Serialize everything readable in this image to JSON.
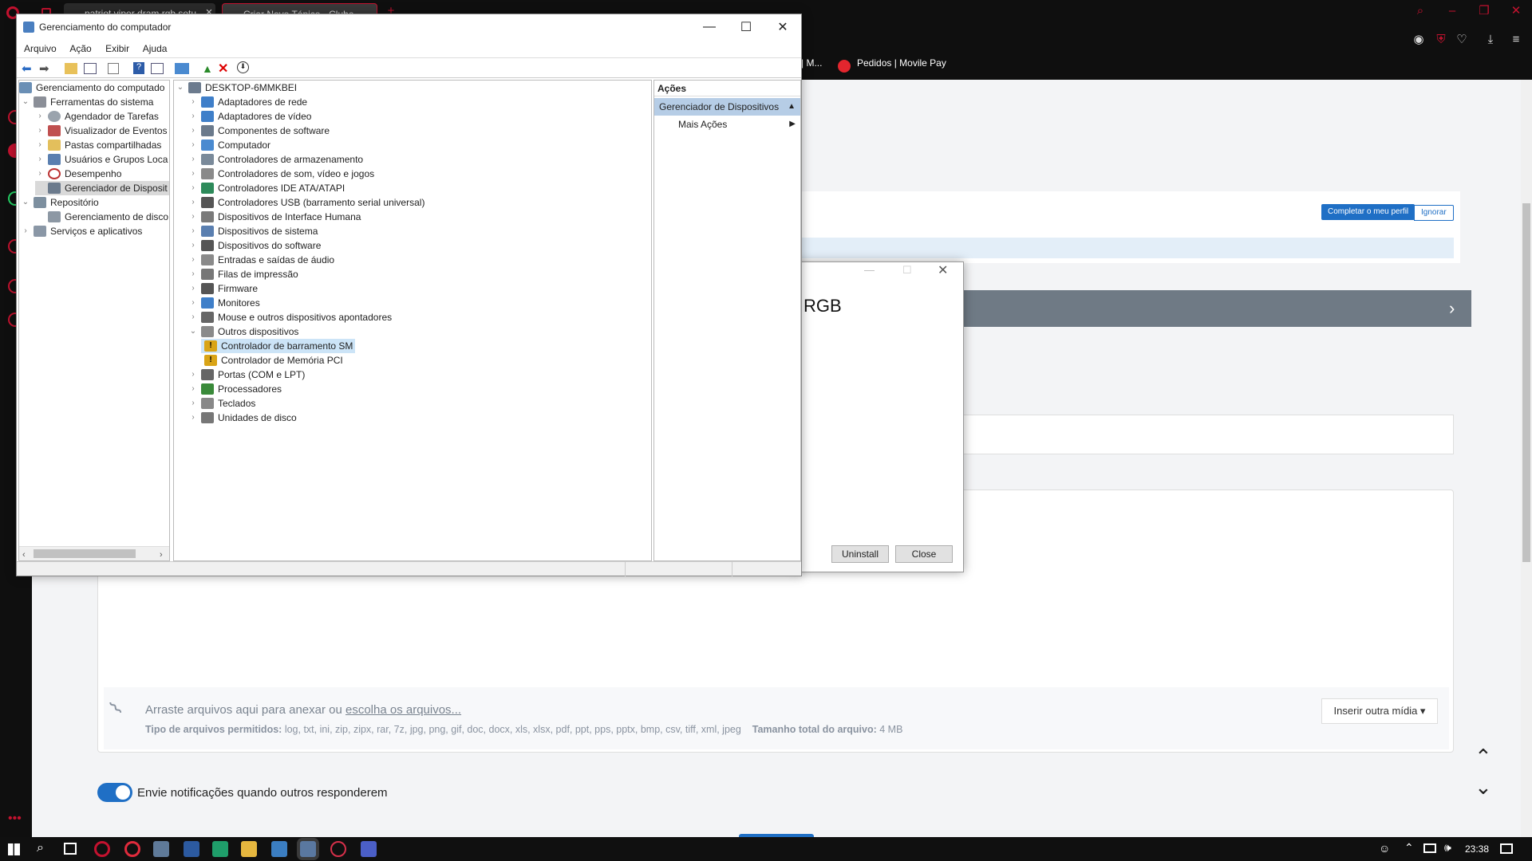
{
  "browser": {
    "tabs": [
      {
        "title": "patriot viper dram rgb setu"
      },
      {
        "title": "Criar Novo Tópico - Clube"
      }
    ],
    "bookmarks": [
      {
        "label": "| M..."
      },
      {
        "label": "Pedidos | Movile Pay"
      }
    ]
  },
  "forum": {
    "profile_complete_label": "Completar o meu perfil",
    "profile_ignore_label": "Ignorar",
    "attach_text": "Arraste arquivos aqui para anexar ou",
    "attach_link": "escolha os arquivos...",
    "allowed_types_label": "Tipo de arquivos permitidos:",
    "allowed_types": "log, txt, ini, zip, zipx, rar, 7z, jpg, png, gif, doc, docx, xls, xlsx, pdf, ppt, pps, pptx, bmp, csv, tiff, xml, jpeg",
    "total_size_label": "Tamanho total do arquivo:",
    "total_size": "4 MB",
    "insert_media_label": "Inserir outra mídia ▾",
    "notify_label": "Envie notificações quando outros responderem",
    "notify_on": true
  },
  "dialog": {
    "title_fragment": "RGB",
    "uninstall_label": "Uninstall",
    "close_label": "Close"
  },
  "mmc": {
    "title": "Gerenciamento do computador",
    "menu": [
      "Arquivo",
      "Ação",
      "Exibir",
      "Ajuda"
    ],
    "left_tree": [
      {
        "label": "Gerenciamento do computado"
      },
      {
        "label": "Ferramentas do sistema"
      },
      {
        "label": "Agendador de Tarefas"
      },
      {
        "label": "Visualizador de Eventos"
      },
      {
        "label": "Pastas compartilhadas"
      },
      {
        "label": "Usuários e Grupos Loca"
      },
      {
        "label": "Desempenho"
      },
      {
        "label": "Gerenciador de Disposit"
      },
      {
        "label": "Repositório"
      },
      {
        "label": "Gerenciamento de disco"
      },
      {
        "label": "Serviços e aplicativos"
      }
    ],
    "device_root": "DESKTOP-6MMKBEI",
    "devices": [
      {
        "label": "Adaptadores de rede"
      },
      {
        "label": "Adaptadores de vídeo"
      },
      {
        "label": "Componentes de software"
      },
      {
        "label": "Computador"
      },
      {
        "label": "Controladores de armazenamento"
      },
      {
        "label": "Controladores de som, vídeo e jogos"
      },
      {
        "label": "Controladores IDE ATA/ATAPI"
      },
      {
        "label": "Controladores USB (barramento serial universal)"
      },
      {
        "label": "Dispositivos de Interface Humana"
      },
      {
        "label": "Dispositivos de sistema"
      },
      {
        "label": "Dispositivos do software"
      },
      {
        "label": "Entradas e saídas de áudio"
      },
      {
        "label": "Filas de impressão"
      },
      {
        "label": "Firmware"
      },
      {
        "label": "Monitores"
      },
      {
        "label": "Mouse e outros dispositivos apontadores"
      },
      {
        "label": "Outros dispositivos"
      },
      {
        "label": "Controlador de barramento SM"
      },
      {
        "label": "Controlador de Memória PCI"
      },
      {
        "label": "Portas (COM e LPT)"
      },
      {
        "label": "Processadores"
      },
      {
        "label": "Teclados"
      },
      {
        "label": "Unidades de disco"
      }
    ],
    "actions_header": "Ações",
    "actions_section": "Gerenciador de Dispositivos",
    "actions_more": "Mais Ações"
  },
  "taskbar": {
    "clock": "23:38"
  }
}
